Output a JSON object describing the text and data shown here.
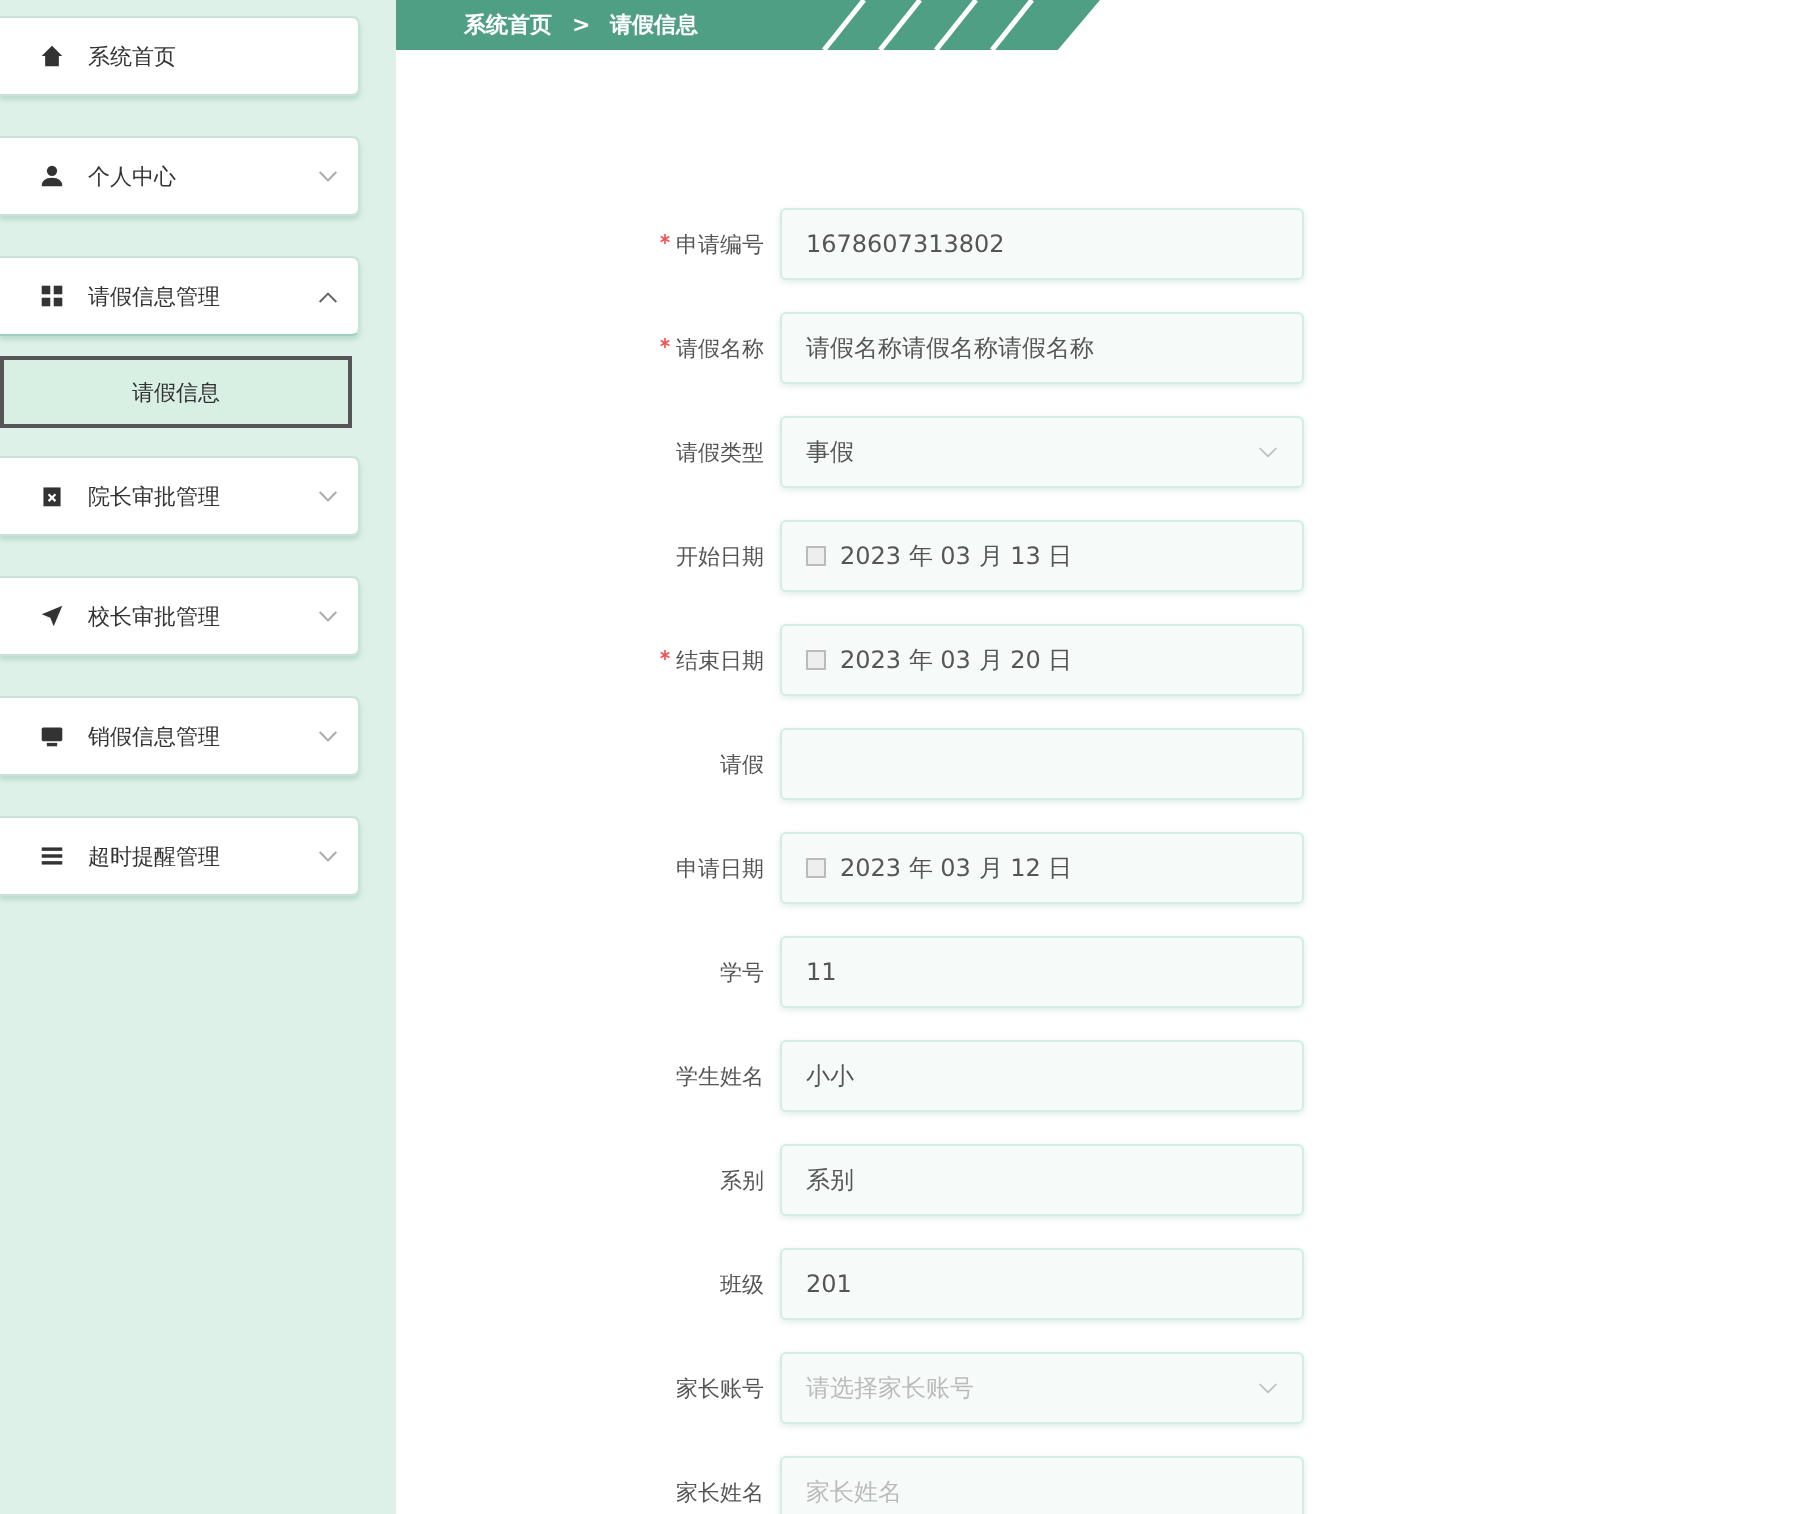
{
  "sidebar": {
    "items": [
      {
        "label": "系统首页"
      },
      {
        "label": "个人中心",
        "expanded": false
      },
      {
        "label": "请假信息管理",
        "expanded": true,
        "children": [
          {
            "label": "请假信息",
            "selected": true
          }
        ]
      },
      {
        "label": "院长审批管理",
        "expanded": false
      },
      {
        "label": "校长审批管理",
        "expanded": false
      },
      {
        "label": "销假信息管理",
        "expanded": false
      },
      {
        "label": "超时提醒管理",
        "expanded": false
      }
    ]
  },
  "breadcrumb": {
    "items": [
      "系统首页",
      "请假信息"
    ],
    "separator": ">"
  },
  "form": {
    "fields": [
      {
        "label": "申请编号",
        "required": true,
        "kind": "text",
        "value": "1678607313802"
      },
      {
        "label": "请假名称",
        "required": true,
        "kind": "text",
        "value": "请假名称请假名称请假名称"
      },
      {
        "label": "请假类型",
        "kind": "select",
        "value": "事假"
      },
      {
        "label": "开始日期",
        "kind": "date",
        "value": "2023 年 03 月 13 日"
      },
      {
        "label": "结束日期",
        "required": true,
        "kind": "date",
        "value": "2023 年 03 月 20 日"
      },
      {
        "label": "请假",
        "kind": "text"
      },
      {
        "label": "申请日期",
        "kind": "date",
        "value": "2023 年 03 月 12 日"
      },
      {
        "label": "学号",
        "kind": "text",
        "value": "11"
      },
      {
        "label": "学生姓名",
        "kind": "text",
        "value": "小小"
      },
      {
        "label": "系别",
        "kind": "text",
        "value": "系别"
      },
      {
        "label": "班级",
        "kind": "text",
        "value": "201"
      },
      {
        "label": "家长账号",
        "kind": "select",
        "placeholder": "请选择家长账号"
      },
      {
        "label": "家长姓名",
        "kind": "text",
        "placeholder": "家长姓名"
      }
    ]
  }
}
